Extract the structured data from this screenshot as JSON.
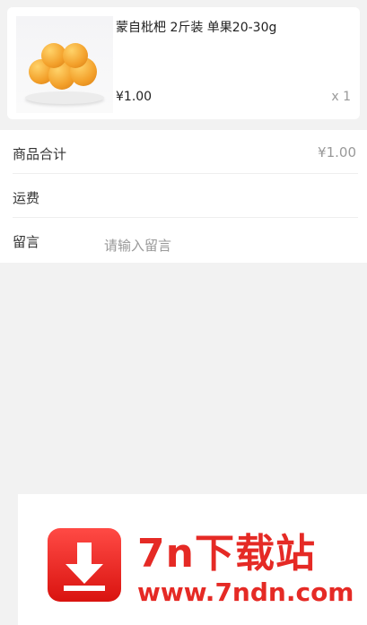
{
  "product": {
    "title": "蒙自枇杷 2斤装 单果20-30g",
    "price": "¥1.00",
    "quantity": "x 1",
    "image_icon": "loquat-fruit-image"
  },
  "summary": {
    "subtotal_label": "商品合计",
    "subtotal_value": "¥1.00",
    "shipping_label": "运费",
    "memo_label": "留言",
    "memo_placeholder": "请输入留言"
  },
  "watermark": {
    "title": "7n下载站",
    "url": "www.7ndn.com",
    "icon": "download-arrow-icon"
  },
  "colors": {
    "background": "#f2f2f2",
    "watermark_red": "#e52a25"
  }
}
